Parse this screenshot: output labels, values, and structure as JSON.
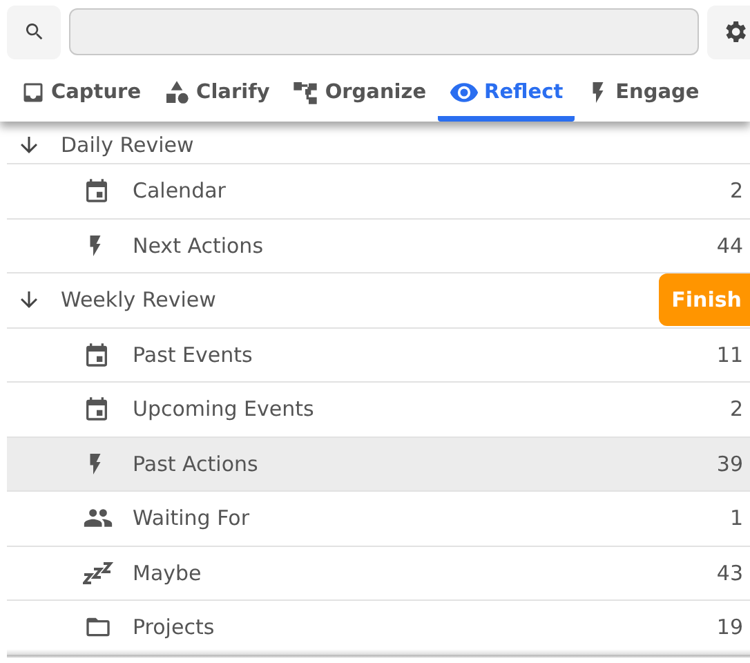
{
  "tabs": [
    {
      "label": "Capture",
      "kind": "inbox",
      "selected": false
    },
    {
      "label": "Clarify",
      "kind": "shapes",
      "selected": false
    },
    {
      "label": "Organize",
      "kind": "tree",
      "selected": false
    },
    {
      "label": "Reflect",
      "kind": "eye",
      "selected": true
    },
    {
      "label": "Engage",
      "kind": "bolt",
      "selected": false
    }
  ],
  "rows": [
    {
      "kind": "group",
      "label": "Daily Review",
      "expanded": true
    },
    {
      "kind": "calendar",
      "label": "Calendar",
      "count": "2",
      "selected": false
    },
    {
      "kind": "bolt",
      "label": "Next Actions",
      "count": "44",
      "selected": false
    },
    {
      "kind": "group",
      "label": "Weekly Review",
      "expanded": true,
      "action": "Finish"
    },
    {
      "kind": "calendar",
      "label": "Past Events",
      "count": "11",
      "selected": false
    },
    {
      "kind": "calendar",
      "label": "Upcoming Events",
      "count": "2",
      "selected": false
    },
    {
      "kind": "bolt",
      "label": "Past Actions",
      "count": "39",
      "selected": true
    },
    {
      "kind": "people",
      "label": "Waiting For",
      "count": "1",
      "selected": false
    },
    {
      "kind": "zzz",
      "label": "Maybe",
      "count": "43",
      "selected": false
    },
    {
      "kind": "folder",
      "label": "Projects",
      "count": "19",
      "selected": false
    }
  ]
}
